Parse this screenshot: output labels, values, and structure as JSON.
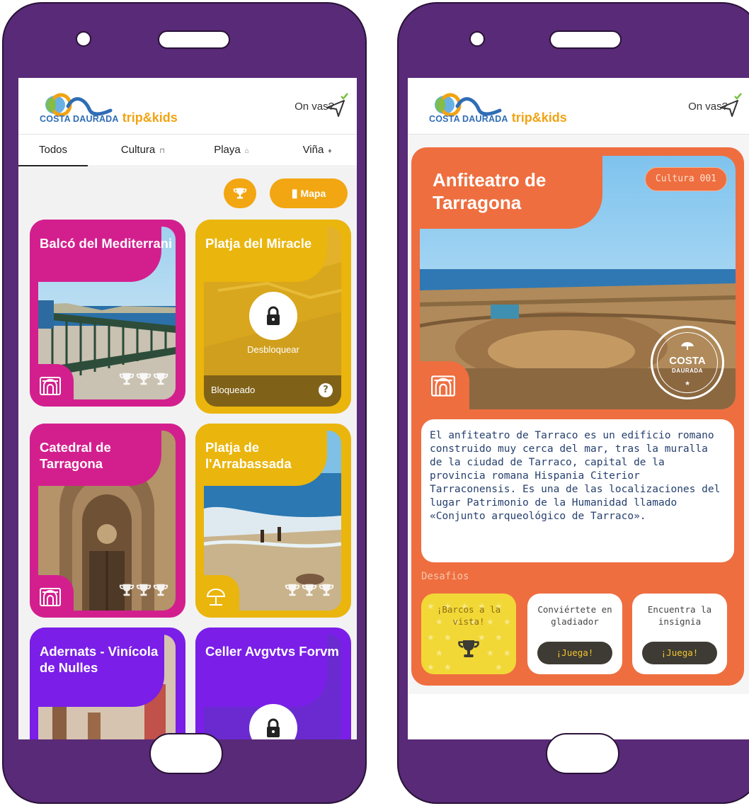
{
  "brand": {
    "costa": "COSTA DAURADA",
    "trip": "trip&kids"
  },
  "header": {
    "on_vas": "On vas?"
  },
  "tabs": [
    {
      "label": "Todos"
    },
    {
      "label": "Cultura"
    },
    {
      "label": "Playa"
    },
    {
      "label": "Viña"
    }
  ],
  "actions": {
    "map_label": "Mapa"
  },
  "cards": [
    {
      "title": "Balcó del Mediterrani",
      "color": "#d31f8e"
    },
    {
      "title": "Platja del Miracle",
      "color": "#eab50d",
      "unlock_label": "Desbloquear",
      "locked_label": "Bloqueado"
    },
    {
      "title": "Catedral de Tarragona",
      "color": "#d31f8e"
    },
    {
      "title": "Platja de l'Arrabassada",
      "color": "#eab50d"
    },
    {
      "title": "Adernats - Vinícola de Nulles",
      "color": "#7a1ee8"
    },
    {
      "title": "Celler Avgvtvs Forvm",
      "color": "#7a1ee8"
    }
  ],
  "detail": {
    "title": "Anfiteatro de Tarragona",
    "badge": "Cultura 001",
    "stamp_costa": "COSTA",
    "stamp_daurada": "DAURADA",
    "description": "El anfiteatro de Tarraco es un edificio romano construido muy cerca del mar, tras la muralla de la ciudad de Tarraco, capital de la provincia romana Hispania Citerior Tarraconensis. Es una de las localizaciones del lugar Patrimonio de la Humanidad llamado «Conjunto arqueológico de Tarraco».",
    "challenges_label": "Desafios",
    "challenges": [
      {
        "label": "¡Barcos a la vista!",
        "completed": true
      },
      {
        "label": "Conviértete en gladiador",
        "button": "¡Juega!"
      },
      {
        "label": "Encuentra la insignia",
        "button": "¡Juega!"
      }
    ],
    "accent_color": "#ee6e3f"
  }
}
